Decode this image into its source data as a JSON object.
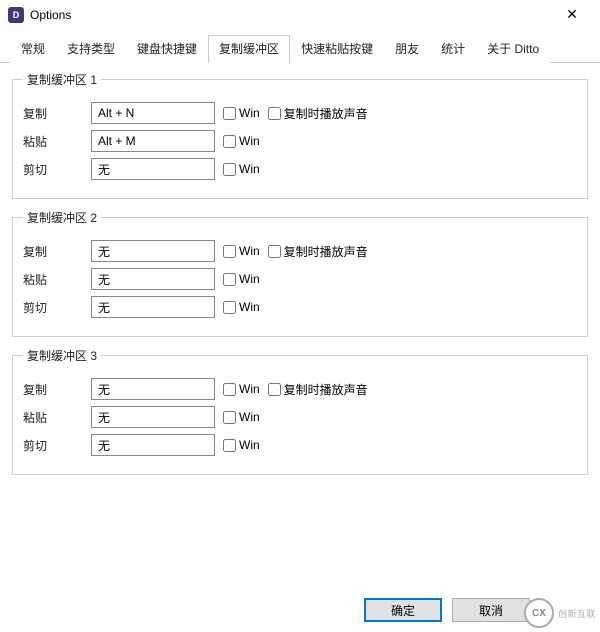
{
  "window": {
    "title": "Options",
    "icon_label": "D"
  },
  "tabs": {
    "items": [
      {
        "label": "常规"
      },
      {
        "label": "支持类型"
      },
      {
        "label": "键盘快捷键"
      },
      {
        "label": "复制缓冲区"
      },
      {
        "label": "快速粘贴按键"
      },
      {
        "label": "朋友"
      },
      {
        "label": "统计"
      },
      {
        "label": "关于 Ditto"
      }
    ],
    "active_index": 3
  },
  "labels": {
    "copy": "复制",
    "paste": "粘贴",
    "cut": "剪切",
    "win": "Win",
    "play_sound": "复制时播放声音",
    "none": "无"
  },
  "groups": [
    {
      "legend": "复制缓冲区 1",
      "copy_value": "Alt + N",
      "paste_value": "Alt + M",
      "cut_value": "无",
      "copy_win": false,
      "paste_win": false,
      "cut_win": false,
      "play_sound": false
    },
    {
      "legend": "复制缓冲区 2",
      "copy_value": "无",
      "paste_value": "无",
      "cut_value": "无",
      "copy_win": false,
      "paste_win": false,
      "cut_win": false,
      "play_sound": false
    },
    {
      "legend": "复制缓冲区 3",
      "copy_value": "无",
      "paste_value": "无",
      "cut_value": "无",
      "copy_win": false,
      "paste_win": false,
      "cut_win": false,
      "play_sound": false
    }
  ],
  "buttons": {
    "ok": "确定",
    "cancel": "取消"
  },
  "watermark": {
    "icon": "CX",
    "text": "创新互联"
  }
}
